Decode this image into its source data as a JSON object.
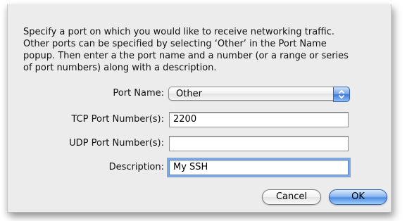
{
  "dialog": {
    "prompt": "Specify a port on which you would like to receive networking traffic.\nOther ports can be specified by selecting ‘Other’ in the Port Name\npopup. Then enter a the port name and a number (or a range or series\nof port numbers) along with a description."
  },
  "form": {
    "port_name": {
      "label": "Port Name:",
      "selected": "Other"
    },
    "tcp": {
      "label": "TCP Port Number(s):",
      "value": "2200"
    },
    "udp": {
      "label": "UDP Port Number(s):",
      "value": ""
    },
    "description": {
      "label": "Description:",
      "value": "My SSH"
    }
  },
  "buttons": {
    "cancel": "Cancel",
    "ok": "OK"
  },
  "icons": {
    "popup_arrows": "up-down-chevron-icon"
  },
  "colors": {
    "default_button": "#4f8de3",
    "focus_ring": "#7fa9dd"
  }
}
